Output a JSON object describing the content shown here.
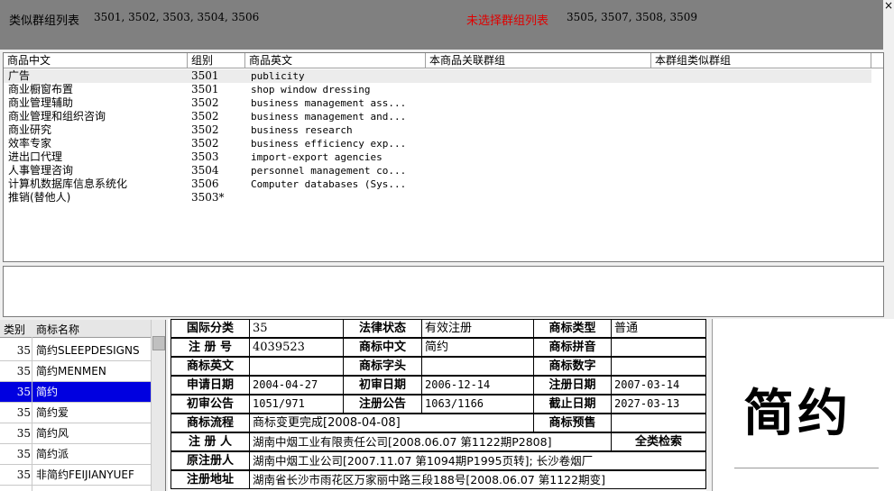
{
  "top": {
    "similar_title": "类似群组列表",
    "similar_groups": "3501, 3502, 3503, 3504, 3506",
    "unselected_title": "未选择群组列表",
    "unselected_groups": "3505, 3507, 3508, 3509",
    "close": "×"
  },
  "colors": {
    "topbar": "#808080",
    "selection": "#0000e0",
    "warn_red": "#e00000"
  },
  "product_table": {
    "headers": [
      "商品中文",
      "组别",
      "商品英文",
      "本商品关联群组",
      "本群组类似群组"
    ],
    "rows": [
      {
        "cn": "广告",
        "group": "3501",
        "en": "publicity"
      },
      {
        "cn": "商业橱窗布置",
        "group": "3501",
        "en": "shop window dressing"
      },
      {
        "cn": "商业管理辅助",
        "group": "3502",
        "en": "business management ass..."
      },
      {
        "cn": "商业管理和组织咨询",
        "group": "3502",
        "en": "business management and..."
      },
      {
        "cn": "商业研究",
        "group": "3502",
        "en": "business research"
      },
      {
        "cn": "效率专家",
        "group": "3502",
        "en": "business efficiency exp..."
      },
      {
        "cn": "进出口代理",
        "group": "3503",
        "en": "import-export agencies"
      },
      {
        "cn": "人事管理咨询",
        "group": "3504",
        "en": "personnel management co..."
      },
      {
        "cn": "计算机数据库信息系统化",
        "group": "3506",
        "en": "Computer databases (Sys..."
      },
      {
        "cn": "推销(替他人)",
        "group": "3503*",
        "en": ""
      }
    ]
  },
  "tm_list": {
    "headers": [
      "类别",
      "商标名称"
    ],
    "rows": [
      {
        "cls": "35",
        "name": "简约SLEEPDESIGNS"
      },
      {
        "cls": "35",
        "name": "简约MENMEN"
      },
      {
        "cls": "35",
        "name": "简约"
      },
      {
        "cls": "35",
        "name": "简约爱"
      },
      {
        "cls": "35",
        "name": "简约风"
      },
      {
        "cls": "35",
        "name": "简约派"
      },
      {
        "cls": "35",
        "name": "非简约FEIJIANYUEF"
      }
    ]
  },
  "detail": {
    "intl_class_label": "国际分类",
    "intl_class": "35",
    "legal_status_label": "法律状态",
    "legal_status": "有效注册",
    "tm_type_label": "商标类型",
    "tm_type": "普通",
    "reg_no_label": "注 册 号",
    "reg_no": "4039523",
    "tm_cn_label": "商标中文",
    "tm_cn": "简约",
    "pinyin_label": "商标拼音",
    "pinyin": "",
    "tm_en_label": "商标英文",
    "tm_en": "",
    "initial_label": "商标字头",
    "initial": "",
    "digits_label": "商标数字",
    "digits": "",
    "apply_date_label": "申请日期",
    "apply_date": "2004-04-27",
    "prelim_date_label": "初审日期",
    "prelim_date": "2006-12-14",
    "reg_date_label": "注册日期",
    "reg_date": "2007-03-14",
    "prelim_notice_label": "初审公告",
    "prelim_notice": "1051/971",
    "reg_notice_label": "注册公告",
    "reg_notice": "1063/1166",
    "expiry_label": "截止日期",
    "expiry": "2027-03-13",
    "flow_label": "商标流程",
    "flow": "商标变更完成[2008-04-08]",
    "presale_label": "商标预售",
    "presale": "",
    "registrant_label": "注 册 人",
    "registrant": "湖南中烟工业有限责任公司[2008.06.07 第1122期P2808]",
    "full_search": "全类检索",
    "orig_registrant_label": "原注册人",
    "orig_registrant": "湖南中烟工业公司[2007.11.07 第1094期P1995页转]; 长沙卷烟厂",
    "address_label": "注册地址",
    "address": "湖南省长沙市雨花区万家丽中路三段188号[2008.06.07 第1122期变]"
  },
  "image": {
    "word": "简约"
  }
}
